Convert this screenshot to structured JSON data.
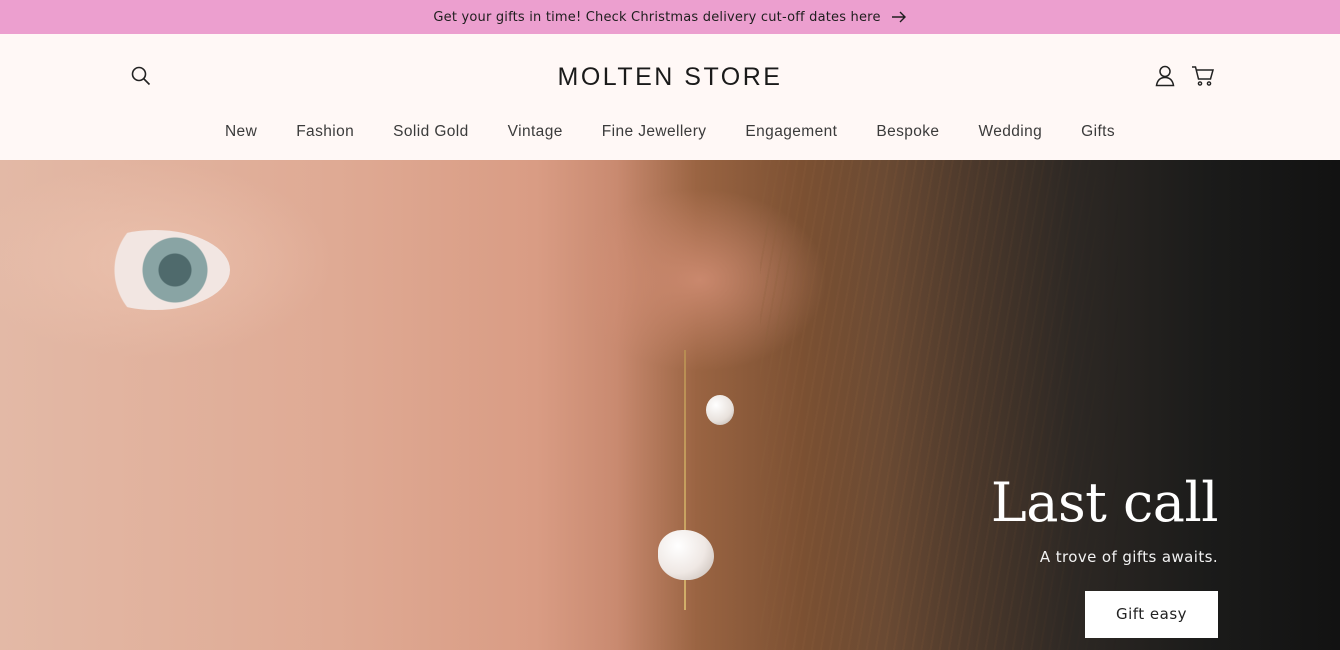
{
  "announcement": {
    "text": "Get your gifts in time! Check Christmas delivery cut-off dates here",
    "arrow_icon": "arrow-right-icon"
  },
  "header": {
    "logo": "MOLTEN STORE",
    "search_icon": "search-icon",
    "account_icon": "user-icon",
    "cart_icon": "cart-icon"
  },
  "nav": {
    "items": [
      {
        "label": "New"
      },
      {
        "label": "Fashion"
      },
      {
        "label": "Solid Gold"
      },
      {
        "label": "Vintage"
      },
      {
        "label": "Fine Jewellery"
      },
      {
        "label": "Engagement"
      },
      {
        "label": "Bespoke"
      },
      {
        "label": "Wedding"
      },
      {
        "label": "Gifts"
      }
    ]
  },
  "hero": {
    "title": "Last call",
    "subtitle": "A trove of gifts awaits.",
    "button_label": "Gift easy"
  },
  "colors": {
    "announcement_bg": "#ec9fcf",
    "header_bg": "#fff8f6",
    "text": "#1a1a1a"
  }
}
